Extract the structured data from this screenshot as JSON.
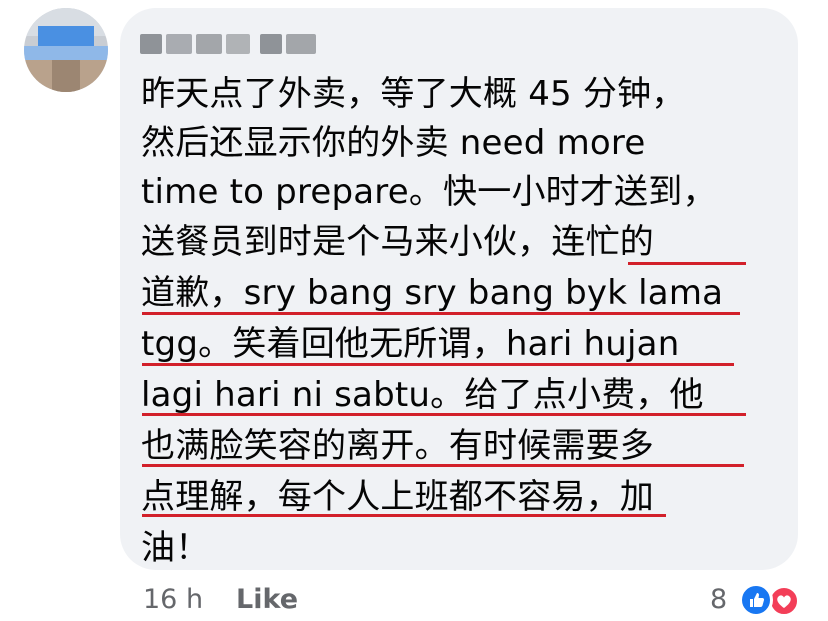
{
  "comment": {
    "lines": [
      "昨天点了外卖，等了大概 45 分钟，",
      "然后还显示你的外卖 need more",
      "time to prepare。快一小时才送到，",
      "送餐员到时是个马来小伙，连忙的",
      "道歉，sry bang sry bang byk lama",
      "tgg。笑着回他无所谓，hari hujan",
      "lagi hari ni sabtu。给了点小费，他",
      "也满脸笑容的离开。有时候需要多",
      "点理解，每个人上班都不容易，加",
      "油！"
    ]
  },
  "footer": {
    "time": "16 h",
    "like_label": "Like",
    "reaction_count": "8",
    "reactions": [
      "thumbs-up-icon",
      "heart-icon"
    ]
  },
  "colors": {
    "bubble": "#f0f2f5",
    "underline": "#d2202a",
    "like_reaction": "#1877f2",
    "love_reaction": "#f33e58"
  }
}
